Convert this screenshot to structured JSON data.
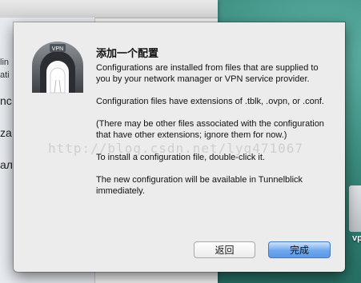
{
  "background_window": {
    "fragments": [
      "lin",
      "ati",
      "nc",
      "zа",
      "ал"
    ]
  },
  "desktop": {
    "icon_label": "vp"
  },
  "dialog": {
    "title": "添加一个配置",
    "paragraphs": [
      "Configurations are installed from files that are supplied to you by your network manager or VPN service provider.",
      "Configuration files have extensions of .tblk, .ovpn, or .conf.",
      "(There may be other files associated with the configuration that have other extensions; ignore them for now.)",
      "To install a configuration file, double-click it.",
      "The new configuration will be available in Tunnelblick immediately."
    ],
    "icon_badge": "VPN",
    "buttons": {
      "back": "返回",
      "done": "完成"
    }
  },
  "watermark": "http://blog.csdn.net/lyq471067",
  "colors": {
    "dialog_bg": "#ececec",
    "primary_button": "#6ea8ee",
    "desktop": "#2f7f72"
  }
}
